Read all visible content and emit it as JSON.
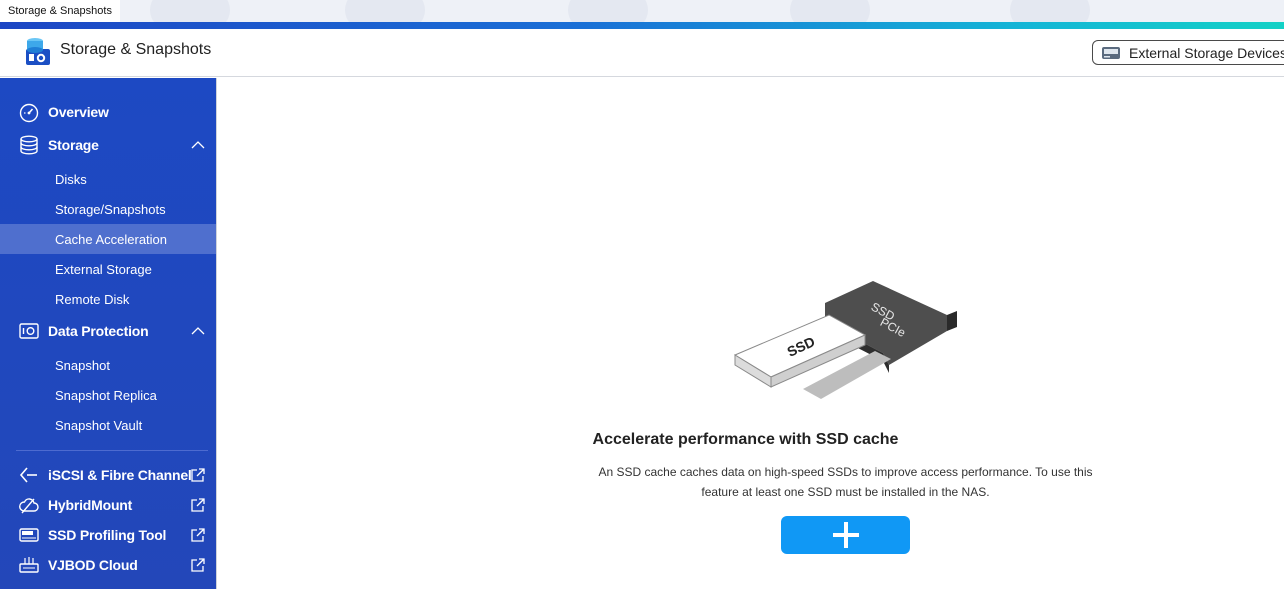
{
  "taskbar": {
    "title": "Storage & Snapshots"
  },
  "header": {
    "title": "Storage & Snapshots",
    "external_button": "External Storage Devices"
  },
  "sidebar": {
    "overview": "Overview",
    "storage": {
      "label": "Storage",
      "items": [
        "Disks",
        "Storage/Snapshots",
        "Cache Acceleration",
        "External Storage",
        "Remote Disk"
      ]
    },
    "data_protection": {
      "label": "Data Protection",
      "items": [
        "Snapshot",
        "Snapshot Replica",
        "Snapshot Vault"
      ]
    },
    "links": [
      "iSCSI & Fibre Channel",
      "HybridMount",
      "SSD Profiling Tool",
      "VJBOD Cloud"
    ]
  },
  "main": {
    "illustration": {
      "card_label": "SSD",
      "pcie_label_1": "SSD",
      "pcie_label_2": "PCIe"
    },
    "headline": "Accelerate performance with SSD cache",
    "description": "An SSD cache caches data on high-speed SSDs to improve access performance. To use this feature at least one SSD must be installed in the NAS."
  },
  "colors": {
    "sidebar": "#1d49c3",
    "sidebar_active": "#4f6fce",
    "accent_button": "#1098f5"
  }
}
